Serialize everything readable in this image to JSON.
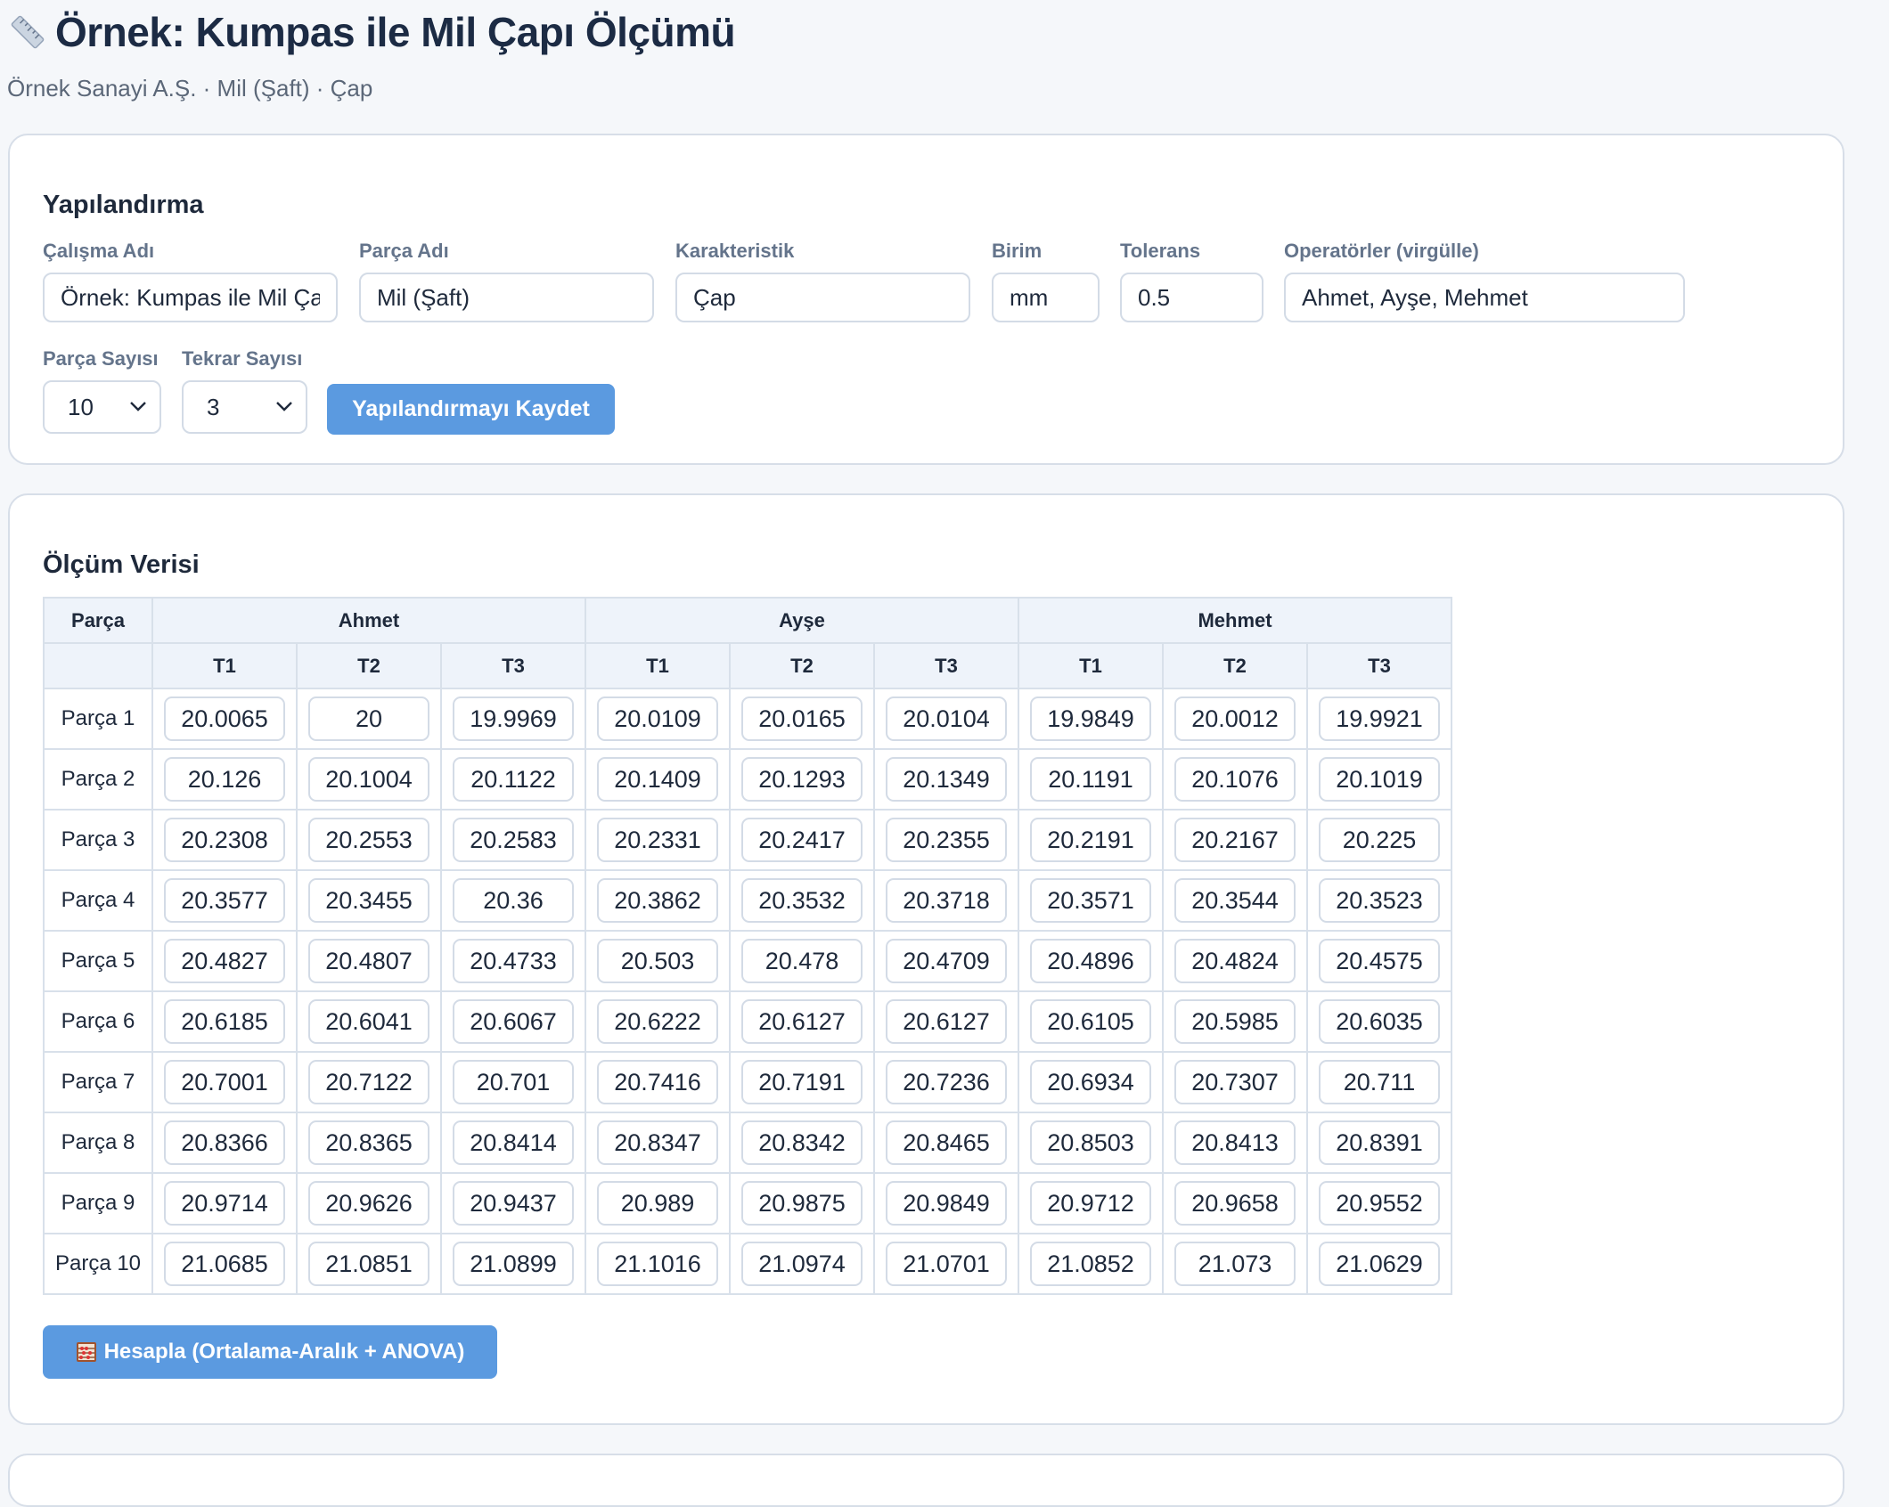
{
  "header": {
    "title": "Örnek: Kumpas ile Mil Çapı Ölçümü",
    "breadcrumb": "Örnek Sanayi A.Ş. · Mil (Şaft) · Çap",
    "icon": "ruler-icon"
  },
  "config": {
    "section_title": "Yapılandırma",
    "study_name": {
      "label": "Çalışma Adı",
      "value": "Örnek: Kumpas ile Mil Çapı Ölçümü"
    },
    "part_name": {
      "label": "Parça Adı",
      "value": "Mil (Şaft)"
    },
    "characteristic": {
      "label": "Karakteristik",
      "value": "Çap"
    },
    "unit": {
      "label": "Birim",
      "value": "mm"
    },
    "tolerance": {
      "label": "Tolerans",
      "value": "0.5"
    },
    "operators": {
      "label": "Operatörler (virgülle)",
      "value": "Ahmet, Ayşe, Mehmet"
    },
    "part_count": {
      "label": "Parça Sayısı",
      "value": "10"
    },
    "trial_count": {
      "label": "Tekrar Sayısı",
      "value": "3"
    },
    "save_label": "Yapılandırmayı Kaydet"
  },
  "data": {
    "section_title": "Ölçüm Verisi",
    "part_header": "Parça",
    "operators": [
      "Ahmet",
      "Ayşe",
      "Mehmet"
    ],
    "trials": [
      "T1",
      "T2",
      "T3"
    ],
    "rows": [
      {
        "label": "Parça 1",
        "values": [
          "20.0065",
          "20",
          "19.9969",
          "20.0109",
          "20.0165",
          "20.0104",
          "19.9849",
          "20.0012",
          "19.9921"
        ]
      },
      {
        "label": "Parça 2",
        "values": [
          "20.126",
          "20.1004",
          "20.1122",
          "20.1409",
          "20.1293",
          "20.1349",
          "20.1191",
          "20.1076",
          "20.1019"
        ]
      },
      {
        "label": "Parça 3",
        "values": [
          "20.2308",
          "20.2553",
          "20.2583",
          "20.2331",
          "20.2417",
          "20.2355",
          "20.2191",
          "20.2167",
          "20.225"
        ]
      },
      {
        "label": "Parça 4",
        "values": [
          "20.3577",
          "20.3455",
          "20.36",
          "20.3862",
          "20.3532",
          "20.3718",
          "20.3571",
          "20.3544",
          "20.3523"
        ]
      },
      {
        "label": "Parça 5",
        "values": [
          "20.4827",
          "20.4807",
          "20.4733",
          "20.503",
          "20.478",
          "20.4709",
          "20.4896",
          "20.4824",
          "20.4575"
        ]
      },
      {
        "label": "Parça 6",
        "values": [
          "20.6185",
          "20.6041",
          "20.6067",
          "20.6222",
          "20.6127",
          "20.6127",
          "20.6105",
          "20.5985",
          "20.6035"
        ]
      },
      {
        "label": "Parça 7",
        "values": [
          "20.7001",
          "20.7122",
          "20.701",
          "20.7416",
          "20.7191",
          "20.7236",
          "20.6934",
          "20.7307",
          "20.711"
        ]
      },
      {
        "label": "Parça 8",
        "values": [
          "20.8366",
          "20.8365",
          "20.8414",
          "20.8347",
          "20.8342",
          "20.8465",
          "20.8503",
          "20.8413",
          "20.8391"
        ]
      },
      {
        "label": "Parça 9",
        "values": [
          "20.9714",
          "20.9626",
          "20.9437",
          "20.989",
          "20.9875",
          "20.9849",
          "20.9712",
          "20.9658",
          "20.9552"
        ]
      },
      {
        "label": "Parça 10",
        "values": [
          "21.0685",
          "21.0851",
          "21.0899",
          "21.1016",
          "21.0974",
          "21.0701",
          "21.0852",
          "21.073",
          "21.0629"
        ]
      }
    ],
    "compute_label": "Hesapla (Ortalama-Aralık + ANOVA)",
    "compute_icon": "abacus-icon"
  },
  "colors": {
    "primary_button": "#5b9ae0",
    "table_header_bg": "#eef3fa",
    "page_bg": "#f5f7fa"
  }
}
